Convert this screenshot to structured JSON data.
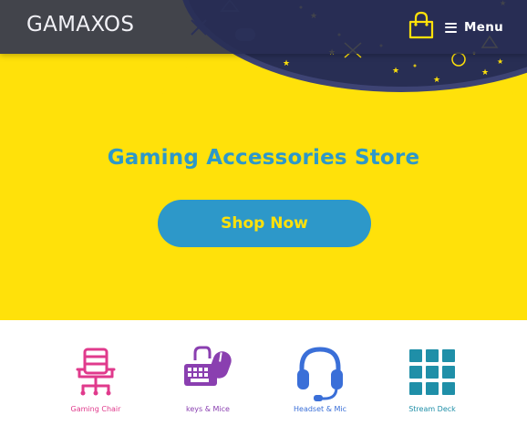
{
  "header": {
    "logo_text": "GAMAXOS",
    "cart_icon": "shopping-bag-icon",
    "menu_icon": "hamburger-icon",
    "menu_label": "Menu"
  },
  "hero": {
    "title": "Gaming Accessories Store",
    "cta_label": "Shop Now"
  },
  "categories": [
    {
      "label": "Gaming Chair",
      "icon": "gaming-chair-icon",
      "color": "#e03a8c"
    },
    {
      "label": "keys & Mice",
      "icon": "keyboard-mouse-icon",
      "color": "#8a3fb0"
    },
    {
      "label": "Headset & Mic",
      "icon": "headset-icon",
      "color": "#3a6fd8"
    },
    {
      "label": "Stream Deck",
      "icon": "stream-deck-icon",
      "color": "#1f8fa8"
    }
  ],
  "colors": {
    "hero_bg": "#ffe10a",
    "header_bg": "#282e54",
    "accent_blue": "#2d98c9",
    "cta_text": "#ffe10a",
    "pattern_bg": "#282e54",
    "pattern_star": "#ffe10a"
  }
}
